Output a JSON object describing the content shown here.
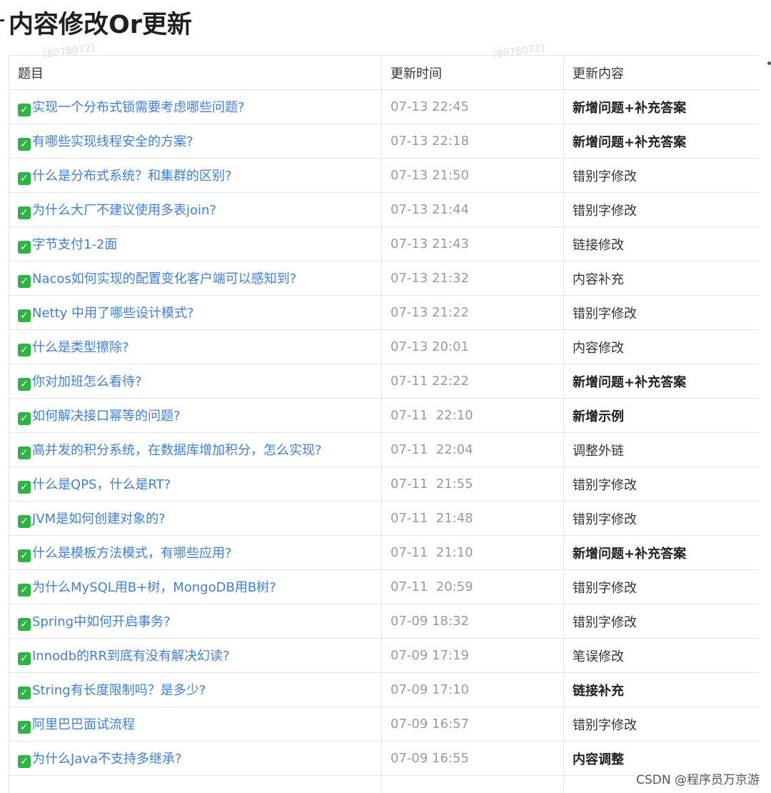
{
  "page": {
    "title": "内容修改Or更新",
    "watermark_text": "(8078072)",
    "csdn_mark": "CSDN @程序员万京游"
  },
  "table": {
    "headers": [
      "题目",
      "更新时间",
      "更新内容"
    ],
    "rows": [
      {
        "question": "实现一个分布式锁需要考虑哪些问题?",
        "time": "07-13 22:45",
        "content": "新增问题+补充答案",
        "bold": true
      },
      {
        "question": "有哪些实现线程安全的方案?",
        "time": "07-13 22:18",
        "content": "新增问题+补充答案",
        "bold": true
      },
      {
        "question": "什么是分布式系统？和集群的区别?",
        "time": "07-13 21:50",
        "content": "错别字修改",
        "bold": false
      },
      {
        "question": "为什么大厂不建议使用多表join?",
        "time": "07-13 21:44",
        "content": "错别字修改",
        "bold": false
      },
      {
        "question": "字节支付1-2面",
        "time": "07-13 21:43",
        "content": "链接修改",
        "bold": false
      },
      {
        "question": "Nacos如何实现的配置变化客户端可以感知到?",
        "time": "07-13 21:32",
        "content": "内容补充",
        "bold": false
      },
      {
        "question": "Netty 中用了哪些设计模式?",
        "time": "07-13 21:22",
        "content": "错别字修改",
        "bold": false
      },
      {
        "question": "什么是类型擦除?",
        "time": "07-13 20:01",
        "content": "内容修改",
        "bold": false
      },
      {
        "question": "你对加班怎么看待?",
        "time": "07-11 22:22",
        "content": "新增问题+补充答案",
        "bold": true
      },
      {
        "question": "如何解决接口幂等的问题?",
        "time": "07-11  22:10",
        "content": "新增示例",
        "bold": true
      },
      {
        "question": "高并发的积分系统，在数据库增加积分，怎么实现?",
        "time": "07-11  22:04",
        "content": "调整外链",
        "bold": false
      },
      {
        "question": "什么是QPS，什么是RT?",
        "time": "07-11  21:55",
        "content": "错别字修改",
        "bold": false
      },
      {
        "question": "JVM是如何创建对象的?",
        "time": "07-11  21:48",
        "content": "错别字修改",
        "bold": false
      },
      {
        "question": "什么是模板方法模式，有哪些应用?",
        "time": "07-11  21:10",
        "content": "新增问题+补充答案",
        "bold": true
      },
      {
        "question": "为什么MySQL用B+树，MongoDB用B树?",
        "time": "07-11  20:59",
        "content": "错别字修改",
        "bold": false
      },
      {
        "question": "Spring中如何开启事务?",
        "time": "07-09 18:32",
        "content": "错别字修改",
        "bold": false
      },
      {
        "question": "Innodb的RR到底有没有解决幻读?",
        "time": "07-09 17:19",
        "content": "笔误修改",
        "bold": false
      },
      {
        "question": "String有长度限制吗？是多少?",
        "time": "07-09 17:10",
        "content": "链接补充",
        "bold": true
      },
      {
        "question": "阿里巴巴面试流程",
        "time": "07-09 16:57",
        "content": "错别字修改",
        "bold": false
      },
      {
        "question": "为什么Java不支持多继承?",
        "time": "07-09 16:55",
        "content": "内容调整",
        "bold": true
      },
      {
        "question": "",
        "time": "",
        "content": "",
        "bold": false
      }
    ]
  },
  "icons": {
    "check": "check-mark-button-icon",
    "check_color": "#2fb344"
  },
  "colors": {
    "link": "#3f7fd8",
    "time": "#9a9a9a",
    "border": "#e3e3e3"
  }
}
